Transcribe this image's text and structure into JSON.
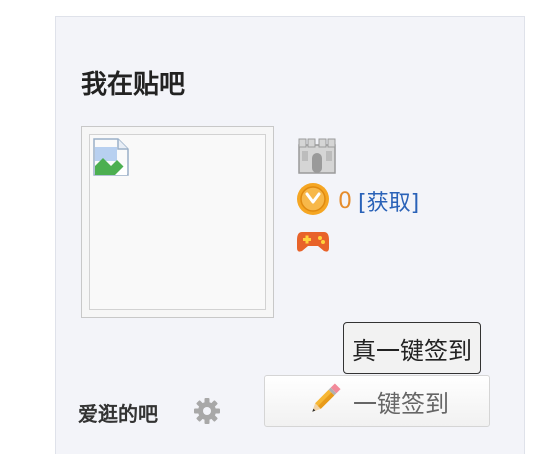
{
  "section": {
    "title": "我在贴吧"
  },
  "coins": {
    "count": "0",
    "get_label": "[获取]"
  },
  "buttons": {
    "real_sign": "真一键签到",
    "sign": "一键签到"
  },
  "favorites": {
    "label": "爱逛的吧"
  },
  "icons": {
    "avatar": "broken-image-icon",
    "tower": "tower-icon",
    "coin": "coin-icon",
    "game": "gamepad-icon",
    "gear": "gear-icon",
    "pencil": "pencil-icon"
  },
  "colors": {
    "coin_count": "#e58c2c",
    "link": "#2a62b8"
  }
}
